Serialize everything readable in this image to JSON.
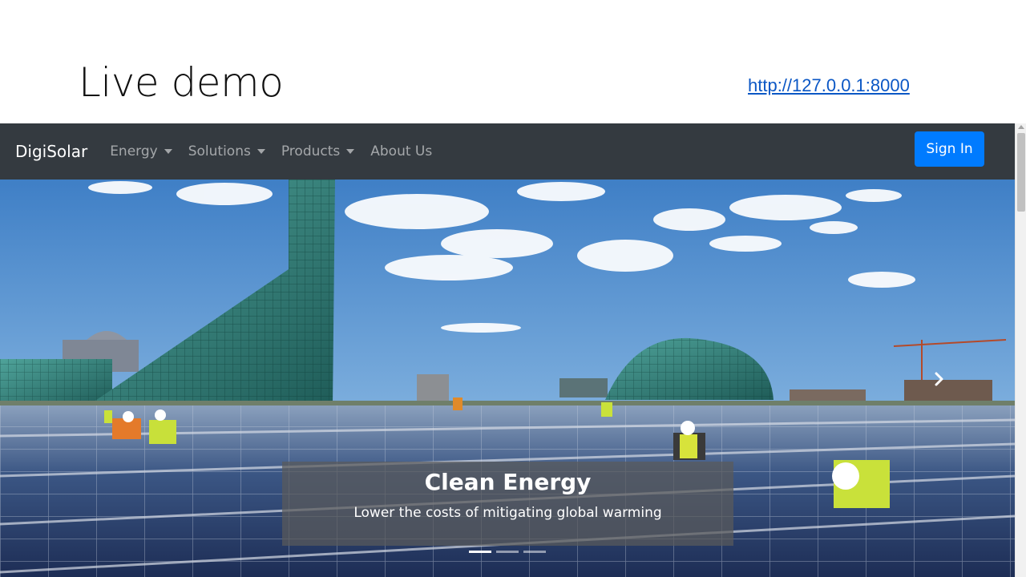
{
  "slide": {
    "title": "Live demo",
    "link": "http://127.0.0.1:8000"
  },
  "navbar": {
    "brand": "DigiSolar",
    "items": [
      {
        "label": "Energy",
        "dropdown": true
      },
      {
        "label": "Solutions",
        "dropdown": true
      },
      {
        "label": "Products",
        "dropdown": true
      },
      {
        "label": "About Us",
        "dropdown": false
      }
    ],
    "signin_label": "Sign In"
  },
  "carousel": {
    "caption_title": "Clean Energy",
    "caption_text": "Lower the costs of mitigating global warming",
    "indicator_count": 3,
    "active_indicator": 1
  },
  "colors": {
    "navbar_bg": "#343a40",
    "primary": "#007bff",
    "link": "#0b57c5"
  },
  "icons": {
    "next": "chevron-right-icon",
    "dropdown": "caret-down-icon"
  }
}
